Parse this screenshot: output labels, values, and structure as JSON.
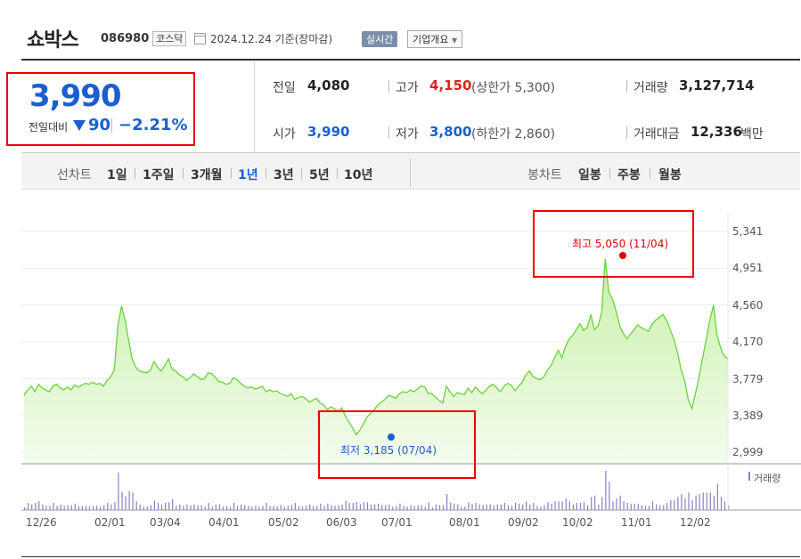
{
  "header": {
    "name": "쇼박스",
    "code": "086980",
    "market": "코스닥",
    "date": "2024.12.24",
    "basis": "기준(장마감)",
    "realtime_label": "실시간",
    "overview_label": "기업개요"
  },
  "quote": {
    "price": "3,990",
    "change_label": "전일대비",
    "change_value": "90",
    "change_pct": "−2.21%",
    "direction": "down",
    "prev_label": "전일",
    "prev": "4,080",
    "open_label": "시가",
    "open": "3,990",
    "high_label": "고가",
    "high": "4,150",
    "upper_limit_label": "(상한가 5,300)",
    "low_label": "저가",
    "low": "3,800",
    "lower_limit_label": "(하한가 2,860)",
    "volume_label": "거래량",
    "volume": "3,127,714",
    "value_label": "거래대금",
    "value": "12,336",
    "value_unit": "백만"
  },
  "tabs": {
    "line_label": "선차트",
    "line": [
      "1일",
      "1주일",
      "3개월",
      "1년",
      "3년",
      "5년",
      "10년"
    ],
    "selected": "1년",
    "candle_label": "봉차트",
    "candle": [
      "일봉",
      "주봉",
      "월봉"
    ]
  },
  "chart_data": {
    "type": "area",
    "y_ticks": [
      "5,341",
      "4,951",
      "4,560",
      "4,170",
      "3,779",
      "3,389",
      "2,999"
    ],
    "ylim": [
      2999,
      5341
    ],
    "x_ticks": [
      "12/26",
      "02/01",
      "03/04",
      "04/01",
      "05/02",
      "06/03",
      "07/01",
      "08/01",
      "09/02",
      "10/02",
      "11/01",
      "12/02"
    ],
    "high_annotation": "최고 5,050 (11/04)",
    "low_annotation": "최저 3,185 (07/04)",
    "volume_legend": "거래량",
    "colors": {
      "line": "#6bd23a",
      "fill_top": "#c8f0a8",
      "fill_bottom": "#f4fcee",
      "high": "#e00000",
      "low": "#1a5fd1",
      "volume": "#8e7cc3"
    },
    "points": [
      3600,
      3660,
      3700,
      3640,
      3720,
      3680,
      3660,
      3640,
      3700,
      3720,
      3680,
      3660,
      3690,
      3660,
      3710,
      3690,
      3710,
      3730,
      3720,
      3740,
      3720,
      3730,
      3700,
      3760,
      3800,
      3870,
      4340,
      4550,
      4400,
      4180,
      3980,
      3900,
      3860,
      3850,
      3840,
      3870,
      3960,
      3900,
      3860,
      3920,
      3990,
      3880,
      3860,
      3820,
      3800,
      3760,
      3790,
      3830,
      3800,
      3770,
      3780,
      3840,
      3830,
      3790,
      3750,
      3740,
      3720,
      3730,
      3790,
      3770,
      3730,
      3700,
      3680,
      3690,
      3670,
      3680,
      3700,
      3640,
      3660,
      3640,
      3650,
      3620,
      3610,
      3590,
      3620,
      3560,
      3580,
      3590,
      3570,
      3530,
      3550,
      3570,
      3520,
      3500,
      3450,
      3480,
      3460,
      3430,
      3470,
      3380,
      3320,
      3260,
      3185,
      3230,
      3300,
      3370,
      3410,
      3450,
      3500,
      3530,
      3560,
      3600,
      3590,
      3570,
      3620,
      3640,
      3630,
      3660,
      3640,
      3670,
      3700,
      3690,
      3620,
      3620,
      3580,
      3550,
      3520,
      3700,
      3640,
      3590,
      3630,
      3620,
      3610,
      3680,
      3630,
      3690,
      3650,
      3620,
      3660,
      3700,
      3720,
      3680,
      3640,
      3700,
      3730,
      3710,
      3650,
      3700,
      3740,
      3820,
      3860,
      3800,
      3780,
      3770,
      3800,
      3870,
      3920,
      4000,
      4080,
      4000,
      4120,
      4200,
      4240,
      4300,
      4360,
      4290,
      4320,
      4460,
      4300,
      4340,
      4480,
      5050,
      4700,
      4620,
      4500,
      4340,
      4260,
      4200,
      4250,
      4300,
      4350,
      4320,
      4300,
      4280,
      4360,
      4400,
      4430,
      4460,
      4400,
      4300,
      4200,
      4060,
      3880,
      3760,
      3560,
      3460,
      3620,
      3800,
      4000,
      4200,
      4400,
      4560,
      4240,
      4100,
      4020,
      3990
    ]
  }
}
